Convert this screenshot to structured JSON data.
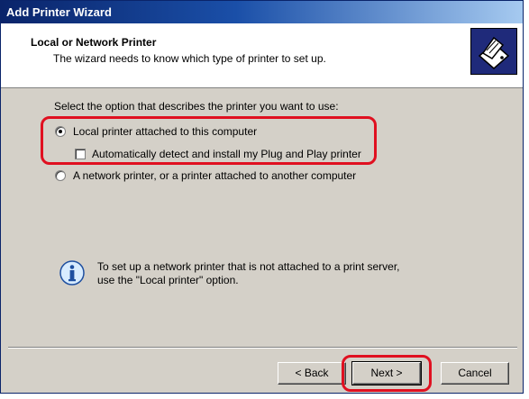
{
  "window": {
    "title": "Add Printer Wizard"
  },
  "header": {
    "title": "Local or Network Printer",
    "subtitle": "The wizard needs to know which type of printer to set up.",
    "icon": "printer-icon"
  },
  "body": {
    "prompt": "Select the option that describes the printer you want to use:",
    "options": [
      {
        "label": "Local printer attached to this computer",
        "selected": true
      },
      {
        "label": "Automatically detect and install my Plug and Play printer",
        "checked": false
      },
      {
        "label": "A network printer, or a printer attached to another computer",
        "selected": false
      }
    ],
    "info_line1": "To set up a network printer that is not attached to a print server,",
    "info_line2": "use the \"Local printer\" option."
  },
  "buttons": {
    "back": "< Back",
    "next": "Next >",
    "cancel": "Cancel"
  },
  "colors": {
    "highlight": "#e01020",
    "titlebar": "#0a246a"
  }
}
